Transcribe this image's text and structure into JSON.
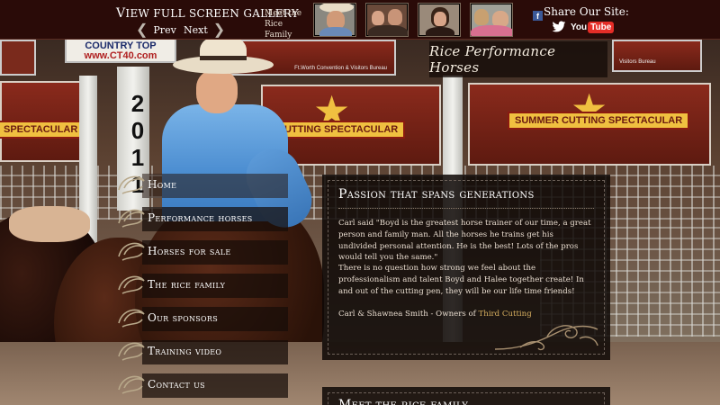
{
  "header": {
    "gallery_link_first": "V",
    "gallery_link_rest": "IEW FULL SCREEN GALLERY",
    "prev_label": "Prev",
    "next_label": "Next",
    "meet_text": "Meet the Rice Family",
    "share_label": "Share Our Site:",
    "youtube_you": "You",
    "youtube_tube": "Tube",
    "facebook_glyph": "f"
  },
  "logo": {
    "text": "Rice Performance Horses"
  },
  "background": {
    "banner_1": "SUMMER CUTTING SPECTACULAR",
    "banner_2": "CUTTING SPECTACULAR",
    "banner_left": "SPECTACULAR",
    "sign_top": "COUNTRY TOP",
    "sign_url": "www.CT40.com",
    "sign_bureau_1": "Ft.Worth Convention & Visitors Bureau",
    "sign_bureau_2": "Visitors Bureau",
    "post_number": "2011"
  },
  "nav": {
    "items": [
      {
        "label": "Home"
      },
      {
        "label": "Performance horses"
      },
      {
        "label": "Horses for sale"
      },
      {
        "label": "The rice family"
      },
      {
        "label": "Our sponsors"
      },
      {
        "label": "Training video"
      },
      {
        "label": "Contact us"
      }
    ]
  },
  "content": {
    "title": "Passion that spans generations",
    "paragraph_1": "Carl said \"Boyd is the greatest horse trainer of our time, a great person and family man. All the horses he trains get his undivided personal attention. He is the best! Lots of the pros would tell you the same.\"",
    "paragraph_2": "There is no question how strong we feel about the professionalism and talent Boyd and Halee together create! In and out of the cutting pen, they will be our life time friends!",
    "signature_prefix": "Carl & Shawnea Smith - Owners of ",
    "signature_link": "Third Cutting"
  },
  "content_2": {
    "title": "Meet the rice family"
  },
  "colors": {
    "topbar": "#2a0b08",
    "link_gold": "#d8b060",
    "shirt_blue": "#4a8cd0",
    "banner_red": "#8a2a1c"
  },
  "icons": {
    "prev": "chevron-left-icon",
    "next": "chevron-right-icon",
    "facebook": "facebook-icon",
    "twitter": "twitter-icon",
    "youtube": "youtube-icon",
    "nav_bullet": "swirl-ornament-icon",
    "panel_ornament": "flourish-ornament-icon"
  }
}
